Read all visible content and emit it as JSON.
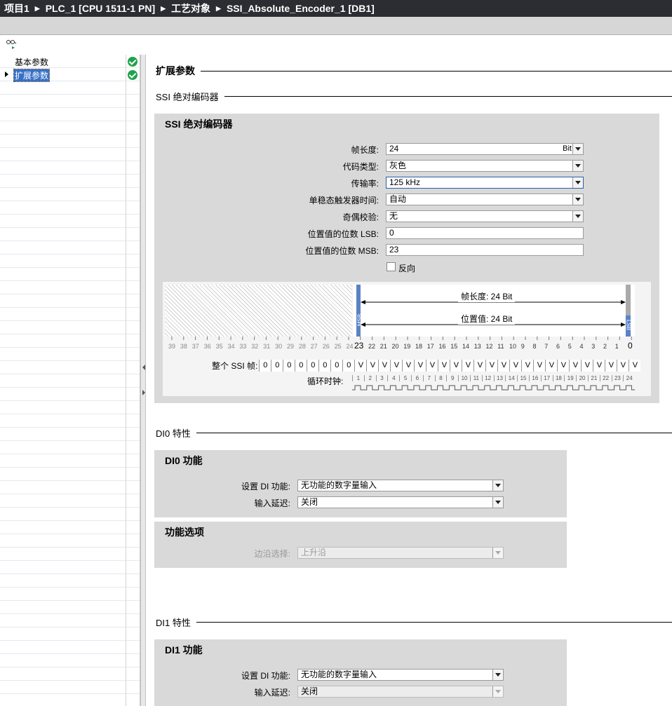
{
  "breadcrumb": [
    "项目1",
    "PLC_1 [CPU 1511-1 PN]",
    "工艺对象",
    "SSI_Absolute_Encoder_1 [DB1]"
  ],
  "sidebar": {
    "items": [
      {
        "label": "基本参数",
        "status": "ok"
      },
      {
        "label": "扩展参数",
        "status": "ok",
        "selected": true
      }
    ]
  },
  "page_title": "扩展参数",
  "ssi_section": {
    "heading": "SSI 绝对编码器",
    "box_title": "SSI 绝对编码器",
    "frame_length": {
      "label": "帧长度:",
      "value": "24",
      "unit": "Bit"
    },
    "code_type": {
      "label": "代码类型:",
      "value": "灰色"
    },
    "baud_rate": {
      "label": "传输率:",
      "value": "125 kHz"
    },
    "monoflop": {
      "label": "单稳态触发器时间:",
      "value": "自动"
    },
    "parity": {
      "label": "奇偶校验:",
      "value": "无"
    },
    "lsb": {
      "label": "位置值的位数 LSB:",
      "value": "0"
    },
    "msb": {
      "label": "位置值的位数 MSB:",
      "value": "23"
    },
    "invert": {
      "label": "反向",
      "checked": false
    },
    "diagram": {
      "frame_length_text": "帧长度: 24 Bit",
      "position_value_text": "位置值: 24 Bit",
      "msb_tag": "MSB",
      "lsb_tag": "LSB",
      "msb_bit": "23",
      "lsb_bit": "0",
      "gray_bits": [
        "39",
        "38",
        "37",
        "36",
        "35",
        "34",
        "33",
        "32",
        "31",
        "30",
        "29",
        "28",
        "27",
        "26",
        "25",
        "24"
      ],
      "active_bits": [
        "22",
        "21",
        "20",
        "19",
        "18",
        "17",
        "16",
        "15",
        "14",
        "13",
        "12",
        "11",
        "10",
        "9",
        "8",
        "7",
        "6",
        "5",
        "4",
        "3",
        "2",
        "1"
      ],
      "ssi_frame_label": "整个 SSI 帧:",
      "ssi_frame_cells": [
        "0",
        "0",
        "0",
        "0",
        "0",
        "0",
        "0",
        "0",
        "V",
        "V",
        "V",
        "V",
        "V",
        "V",
        "V",
        "V",
        "V",
        "V",
        "V",
        "V",
        "V",
        "V",
        "V",
        "V",
        "V",
        "V",
        "V",
        "V",
        "V",
        "V",
        "V",
        "V"
      ],
      "clock_label": "循环时钟:",
      "clocks": [
        "1",
        "2",
        "3",
        "4",
        "5",
        "6",
        "7",
        "8",
        "9",
        "10",
        "11",
        "12",
        "13",
        "14",
        "15",
        "16",
        "17",
        "18",
        "19",
        "20",
        "21",
        "22",
        "23",
        "24"
      ]
    }
  },
  "di0_section": {
    "heading": "DI0 特性",
    "func_box_title": "DI0 功能",
    "di_function": {
      "label": "设置 DI 功能:",
      "value": "无功能的数字量输入"
    },
    "input_delay": {
      "label": "输入延迟:",
      "value": "关闭"
    },
    "options_title": "功能选项",
    "edge_select": {
      "label": "边沿选择:",
      "value": "上升沿"
    }
  },
  "di1_section": {
    "heading": "DI1 特性",
    "func_box_title": "DI1 功能",
    "di_function": {
      "label": "设置 DI 功能:",
      "value": "无功能的数字量输入"
    },
    "input_delay": {
      "label": "输入延迟:",
      "value": "关闭"
    }
  }
}
